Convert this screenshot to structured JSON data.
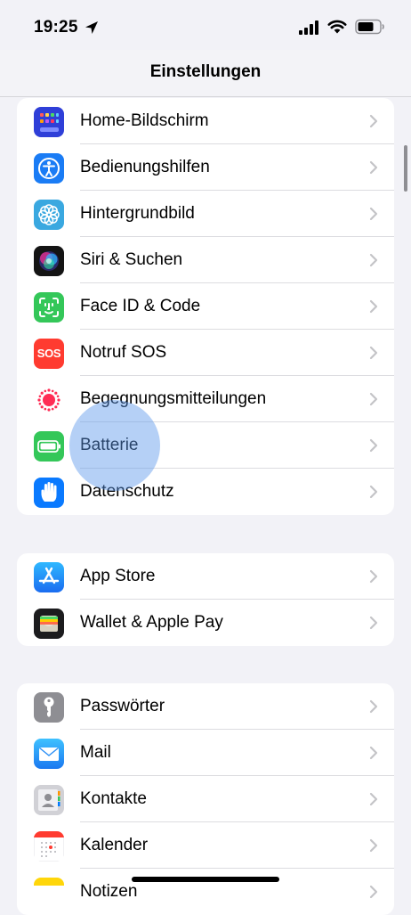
{
  "status": {
    "time": "19:25"
  },
  "nav": {
    "title": "Einstellungen"
  },
  "groups": [
    {
      "items": [
        {
          "label": "Home-Bildschirm",
          "icon": "home-screen-icon",
          "color": "#2f3fd8"
        },
        {
          "label": "Bedienungshilfen",
          "icon": "accessibility-icon",
          "color": "#1a7cf5"
        },
        {
          "label": "Hintergrundbild",
          "icon": "wallpaper-flower-icon",
          "color": "#3aa8e0"
        },
        {
          "label": "Siri & Suchen",
          "icon": "siri-icon",
          "color": "#141414"
        },
        {
          "label": "Face ID & Code",
          "icon": "face-id-icon",
          "color": "#34c759"
        },
        {
          "label": "Notruf SOS",
          "icon": "sos-icon",
          "color": "#ff3b30",
          "icon_text": "SOS"
        },
        {
          "label": "Begegnungsmitteilungen",
          "icon": "exposure-notification-icon",
          "color": "#ff2d55"
        },
        {
          "label": "Batterie",
          "icon": "battery-icon",
          "color": "#34c759"
        },
        {
          "label": "Datenschutz",
          "icon": "privacy-hand-icon",
          "color": "#0a7aff"
        }
      ]
    },
    {
      "items": [
        {
          "label": "App Store",
          "icon": "app-store-icon",
          "color": "#1a8cff"
        },
        {
          "label": "Wallet & Apple Pay",
          "icon": "wallet-icon",
          "color": "#1c1c1e"
        }
      ]
    },
    {
      "items": [
        {
          "label": "Passwörter",
          "icon": "key-icon",
          "color": "#8e8e93"
        },
        {
          "label": "Mail",
          "icon": "mail-icon",
          "color": "#1e90ff"
        },
        {
          "label": "Kontakte",
          "icon": "contacts-icon",
          "color": "#c7c7cc"
        },
        {
          "label": "Kalender",
          "icon": "calendar-icon",
          "color": "#ffffff"
        },
        {
          "label": "Notizen",
          "icon": "notes-icon",
          "color": "#ffd60a"
        }
      ]
    }
  ]
}
